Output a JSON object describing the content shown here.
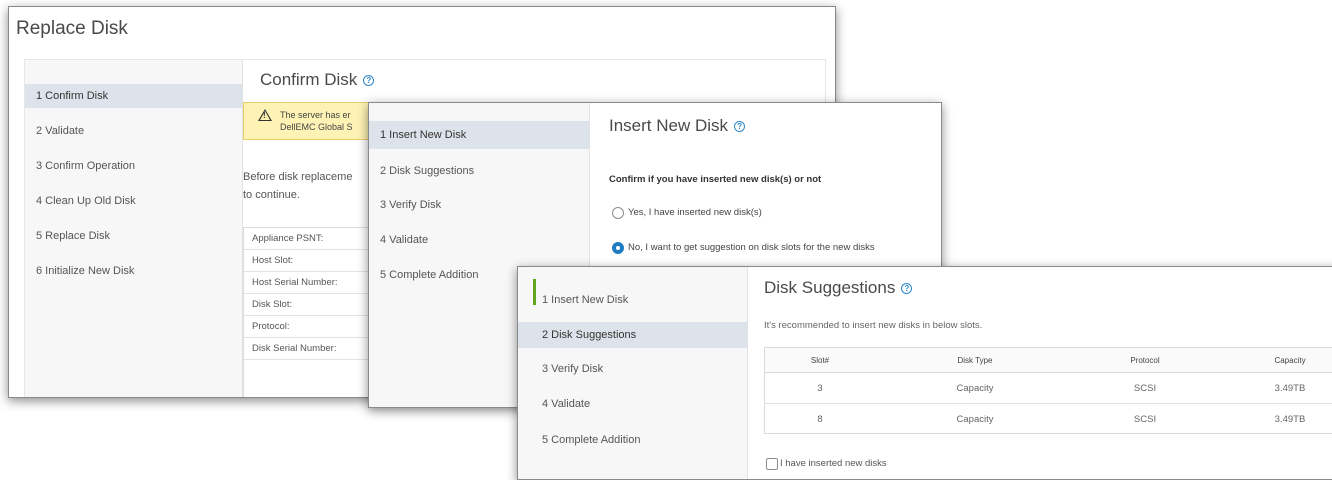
{
  "replace_disk": {
    "window_title": "Replace Disk",
    "steps": [
      "1  Confirm Disk",
      "2  Validate",
      "3  Confirm Operation",
      "4  Clean Up Old Disk",
      "5  Replace Disk",
      "6  Initialize New Disk"
    ],
    "active_step": 0,
    "pane_title": "Confirm Disk",
    "alert_lines": [
      "The server has er",
      "DellEMC Global S"
    ],
    "body_lines": [
      "Before disk replaceme",
      "to continue."
    ],
    "info_rows": [
      "Appliance PSNT:",
      "Host Slot:",
      "Host Serial Number:",
      "Disk Slot:",
      "Protocol:",
      "Disk Serial Number:"
    ]
  },
  "insert_new_disk": {
    "steps": [
      "1 Insert New Disk",
      "2 Disk Suggestions",
      "3 Verify Disk",
      "4 Validate",
      "5 Complete Addition"
    ],
    "active_step": 0,
    "pane_title": "Insert New Disk",
    "question": "Confirm if you have inserted new disk(s) or not",
    "options": [
      {
        "label": "Yes, I have inserted new disk(s)",
        "selected": false
      },
      {
        "label": "No, I want to get suggestion on disk slots for the new disks",
        "selected": true
      }
    ]
  },
  "disk_suggestions": {
    "steps": [
      "1 Insert New Disk",
      "2 Disk Suggestions",
      "3 Verify Disk",
      "4 Validate",
      "5 Complete Addition"
    ],
    "active_step": 1,
    "pane_title": "Disk Suggestions",
    "description": "It's recommended to insert new disks in below slots.",
    "columns": [
      "Slot#",
      "Disk Type",
      "Protocol",
      "Capacity"
    ],
    "rows": [
      [
        "3",
        "Capacity",
        "SCSI",
        "3.49TB"
      ],
      [
        "8",
        "Capacity",
        "SCSI",
        "3.49TB"
      ]
    ],
    "checkbox_label": "I have inserted new disks",
    "checkbox_checked": false
  },
  "colors": {
    "accent_blue": "#1f7cc1",
    "active_step_bg": "#dde3ea",
    "alert_bg": "#fef3b5",
    "progress_green": "#62a420"
  },
  "icons": [
    "help-icon",
    "warning-icon",
    "radio-icon",
    "checkbox-icon"
  ]
}
